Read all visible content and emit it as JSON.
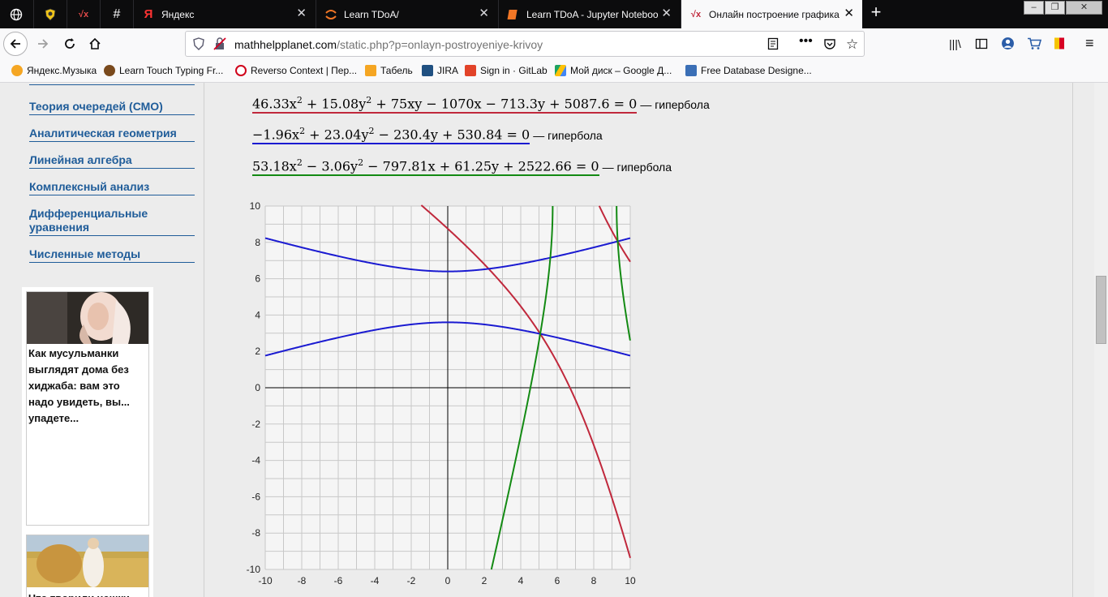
{
  "tabs": [
    {
      "label": "",
      "icon": "globe-icon"
    },
    {
      "label": "",
      "icon": "shield-tab-icon"
    },
    {
      "label": "",
      "icon": "sqrt-x-icon"
    },
    {
      "label": "",
      "icon": "hash-icon"
    },
    {
      "label": "Яндекс",
      "icon": "yandex-icon"
    },
    {
      "label": "Learn TDoA/",
      "icon": "jupyter-icon"
    },
    {
      "label": "Learn TDoA - Jupyter Notebook",
      "icon": "notebook-icon"
    },
    {
      "label": "Онлайн построение графика",
      "icon": "sqrt-x-icon"
    }
  ],
  "nav": {
    "url_domain": "mathhelpplanet.com",
    "url_path": "/static.php?p=onlayn-postroyeniye-krivoy"
  },
  "bookmarks": [
    {
      "label": "Яндекс.Музыка",
      "color": "#f5a623"
    },
    {
      "label": "Learn Touch Typing Fr...",
      "color": "#7a4a1d"
    },
    {
      "label": "Reverso Context | Пер...",
      "color": "#d0021b"
    },
    {
      "label": "Табель",
      "color": "#f5a623"
    },
    {
      "label": "JIRA",
      "color": "#205081"
    },
    {
      "label": "Sign in · GitLab",
      "color": "#e24329"
    },
    {
      "label": "Мой диск – Google Д...",
      "color": "#1ea362"
    },
    {
      "label": "Free Database Designe...",
      "color": "#3b6fb6"
    }
  ],
  "sidebar": {
    "items": [
      "Теория очередей (СМО)",
      "Аналитическая геометрия",
      "Линейная алгебра",
      "Комплексный анализ",
      "Дифференциальные уравнения",
      "Численные методы"
    ]
  },
  "ads": [
    {
      "text": "Как мусульманки выглядят дома без хиджаба: вам это надо увидеть, вы... упадете..."
    },
    {
      "text": "Что творили чешки"
    }
  ],
  "equations": [
    {
      "html": "46.33x<sup>2</sup> + 15.08y<sup>2</sup> + 75xy − 1070x − 713.3y + 5087.6 = 0",
      "label": "— гипербола",
      "color": "#c0283c"
    },
    {
      "html": "−1.96x<sup>2</sup> + 23.04y<sup>2</sup> − 230.4y + 530.84 = 0",
      "label": "— гипербола",
      "color": "#1a1ad1"
    },
    {
      "html": "53.18x<sup>2</sup> − 3.06y<sup>2</sup> − 797.81x + 61.25y + 2522.66 = 0",
      "label": "— гипербола",
      "color": "#138a13"
    }
  ],
  "chart_data": {
    "type": "line",
    "xlim": [
      -10,
      10
    ],
    "ylim": [
      -10,
      10
    ],
    "x_ticks": [
      -10,
      -8,
      -6,
      -4,
      -2,
      0,
      2,
      4,
      6,
      8,
      10
    ],
    "y_ticks": [
      10,
      8,
      6,
      4,
      2,
      0,
      -2,
      -4,
      -6,
      -8,
      -10
    ],
    "grid": true,
    "series": [
      {
        "color": "#c0283c",
        "coef": [
          46.33,
          75,
          15.08,
          -1070,
          -713.3,
          5087.6
        ]
      },
      {
        "color": "#1a1ad1",
        "coef": [
          -1.96,
          0,
          23.04,
          0,
          -230.4,
          530.84
        ]
      },
      {
        "color": "#138a13",
        "coef": [
          53.18,
          0,
          -3.06,
          -797.81,
          61.25,
          2522.66
        ]
      }
    ]
  }
}
